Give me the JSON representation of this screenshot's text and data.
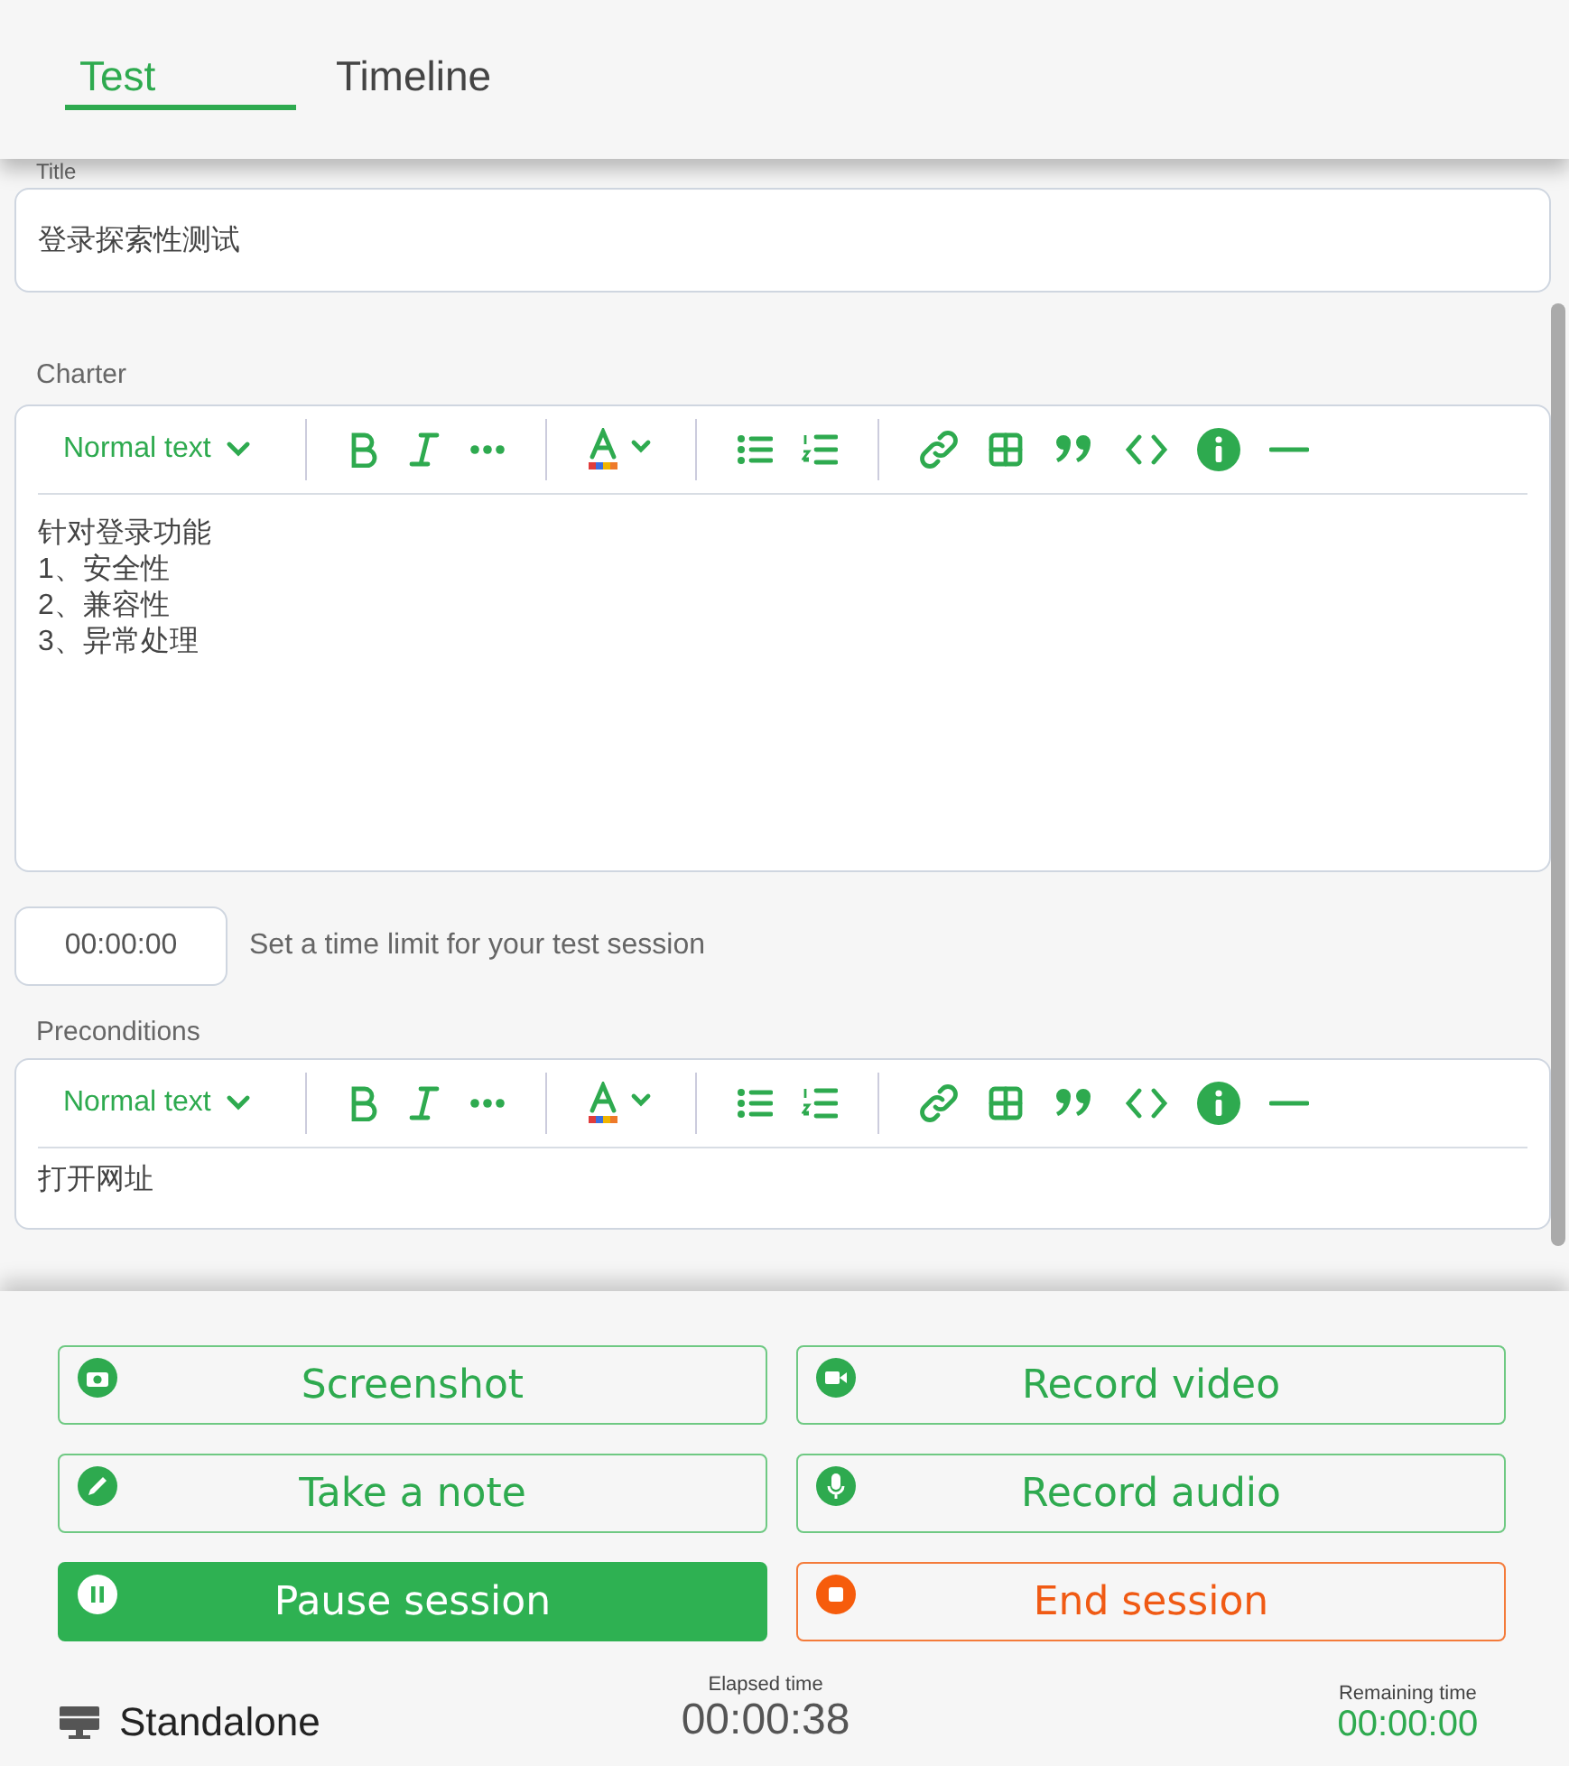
{
  "tabs": [
    {
      "label": "Test",
      "selected": true
    },
    {
      "label": "Timeline",
      "selected": false
    }
  ],
  "title_field": {
    "label": "Title",
    "value": "登录探索性测试"
  },
  "charter": {
    "label": "Charter",
    "format": "Normal text",
    "lines": [
      "针对登录功能",
      "1、安全性",
      "2、兼容性",
      "3、异常处理"
    ]
  },
  "time_limit": {
    "value": "00:00:00",
    "hint": "Set a time limit for your test session"
  },
  "preconditions": {
    "label": "Preconditions",
    "format": "Normal text",
    "lines": [
      "打开网址"
    ]
  },
  "actions": [
    {
      "label": "Screenshot",
      "kind": "outline"
    },
    {
      "label": "Record video",
      "kind": "outline"
    },
    {
      "label": "Take a note",
      "kind": "outline"
    },
    {
      "label": "Record audio",
      "kind": "outline"
    },
    {
      "label": "Pause session",
      "kind": "primary"
    },
    {
      "label": "End session",
      "kind": "danger"
    }
  ],
  "footer": {
    "mode": "Standalone",
    "elapsed_label": "Elapsed time",
    "elapsed": "00:00:38",
    "remaining_label": "Remaining time",
    "remaining": "00:00:00"
  }
}
